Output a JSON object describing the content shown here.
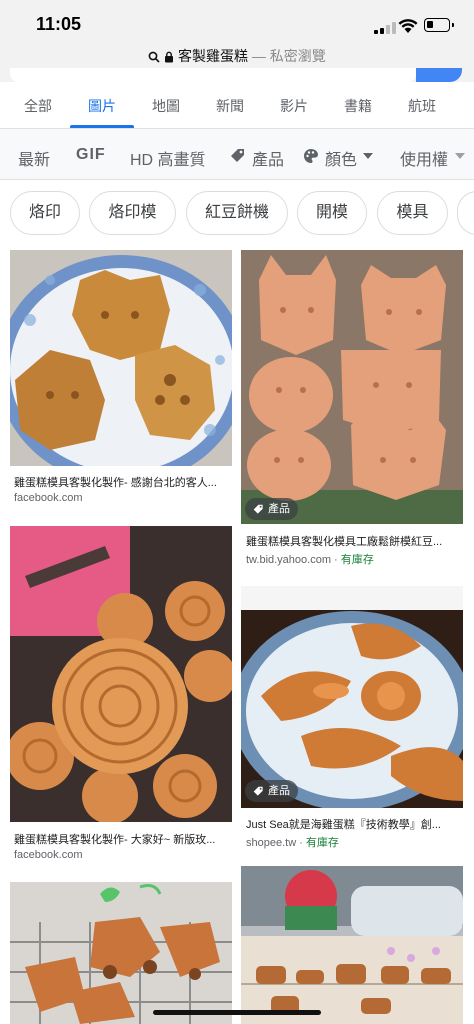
{
  "status": {
    "time": "11:05"
  },
  "urlbar": {
    "query": "客製雞蛋糕",
    "mode": "— 私密瀏覽"
  },
  "tabs": [
    {
      "label": "全部"
    },
    {
      "label": "圖片"
    },
    {
      "label": "地圖"
    },
    {
      "label": "新聞"
    },
    {
      "label": "影片"
    },
    {
      "label": "書籍"
    },
    {
      "label": "航班"
    }
  ],
  "filters": {
    "latest": "最新",
    "gif": "GIF",
    "hd": "HD 高畫質",
    "products": "產品",
    "color": "顏色",
    "rights": "使用權"
  },
  "chips": [
    {
      "label": "烙印"
    },
    {
      "label": "烙印模"
    },
    {
      "label": "紅豆餅機"
    },
    {
      "label": "開模"
    },
    {
      "label": "模具"
    }
  ],
  "results": [
    {
      "caption": "雞蛋糕模具客製化製作- 感謝台北的客人...",
      "source": "facebook.com",
      "stock": "",
      "badge": ""
    },
    {
      "caption": "雞蛋糕模具客製化模具工廠鬆餅模紅豆...",
      "source": "tw.bid.yahoo.com · ",
      "stock": "有庫存",
      "badge": "產品"
    },
    {
      "caption": "雞蛋糕模具客製化製作- 大家好~ 新版玫...",
      "source": "facebook.com",
      "stock": "",
      "badge": ""
    },
    {
      "caption": "Just Sea就是海雞蛋糕『技術教學』創...",
      "source": "shopee.tw · ",
      "stock": "有庫存",
      "badge": "產品"
    },
    {
      "caption": "",
      "source": "",
      "stock": "",
      "badge": ""
    },
    {
      "caption": "",
      "source": "",
      "stock": "",
      "badge": ""
    }
  ],
  "colors": {
    "accent": "#1a73e8",
    "stock": "#188038"
  }
}
